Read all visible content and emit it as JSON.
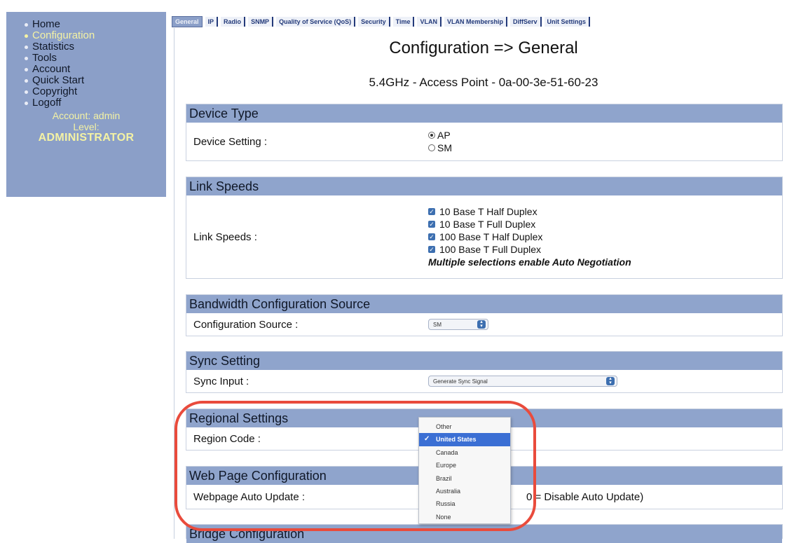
{
  "sidebar": {
    "items": [
      {
        "label": "Home",
        "active": false
      },
      {
        "label": "Configuration",
        "active": true
      },
      {
        "label": "Statistics",
        "active": false
      },
      {
        "label": "Tools",
        "active": false
      },
      {
        "label": "Account",
        "active": false
      },
      {
        "label": "Quick Start",
        "active": false
      },
      {
        "label": "Copyright",
        "active": false
      },
      {
        "label": "Logoff",
        "active": false
      }
    ],
    "account_line": "Account: admin",
    "level_line": "Level:",
    "level_value": "ADMINISTRATOR"
  },
  "tabs": [
    "General",
    "IP",
    "Radio",
    "SNMP",
    "Quality of Service (QoS)",
    "Security",
    "Time",
    "VLAN",
    "VLAN Membership",
    "DiffServ",
    "Unit Settings"
  ],
  "page": {
    "title": "Configuration => General",
    "subtitle": "5.4GHz - Access Point - 0a-00-3e-51-60-23"
  },
  "sections": {
    "device_type": {
      "heading": "Device Type",
      "label": "Device Setting :",
      "options": [
        "AP",
        "SM"
      ],
      "selected": "AP"
    },
    "link_speeds": {
      "heading": "Link Speeds",
      "label": "Link Speeds :",
      "options": [
        "10 Base T Half Duplex",
        "10 Base T Full Duplex",
        "100 Base T Half Duplex",
        "100 Base T Full Duplex"
      ],
      "note": "Multiple selections enable Auto Negotiation"
    },
    "bandwidth": {
      "heading": "Bandwidth Configuration Source",
      "label": "Configuration Source :",
      "value": "SM"
    },
    "sync": {
      "heading": "Sync Setting",
      "label": "Sync Input :",
      "value": "Generate Sync Signal"
    },
    "regional": {
      "heading": "Regional Settings",
      "label": "Region Code :"
    },
    "webpage": {
      "heading": "Web Page Configuration",
      "label": "Webpage Auto Update :",
      "hint": "0 = Disable Auto Update)"
    },
    "bridge": {
      "heading": "Bridge Configuration"
    }
  },
  "dropdown": {
    "options": [
      "Other",
      "United States",
      "Canada",
      "Europe",
      "Brazil",
      "Australia",
      "Russia",
      "None"
    ],
    "selected": "United States"
  },
  "colors": {
    "sidebar_bg": "#8b9fc8",
    "section_header": "#8fa4cc",
    "highlight": "#e94b3c",
    "selected_item": "#3b6fd4"
  }
}
